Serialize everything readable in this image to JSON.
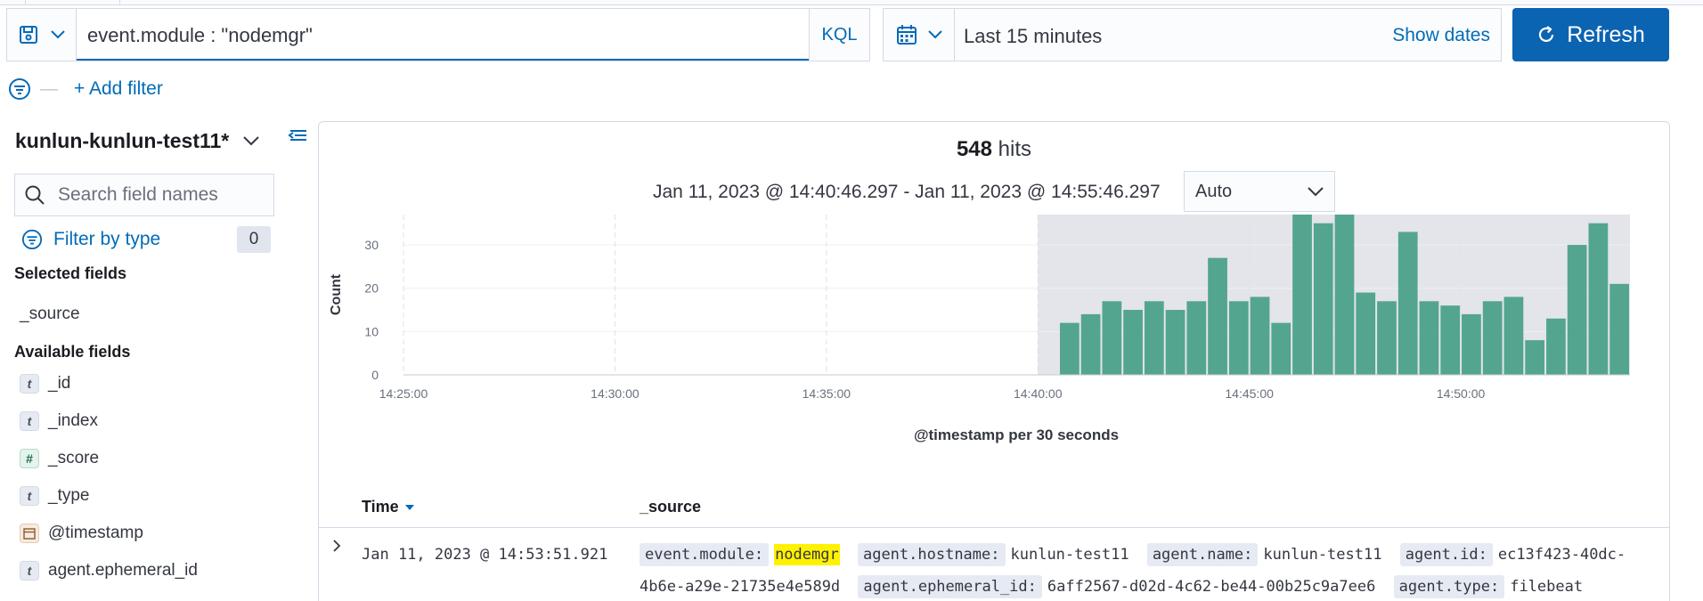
{
  "query": {
    "value": "event.module : \"nodemgr\"",
    "language": "KQL"
  },
  "date": {
    "range": "Last 15 minutes",
    "show_dates": "Show dates"
  },
  "refresh": {
    "label": "Refresh"
  },
  "filters": {
    "add_label": "+ Add filter"
  },
  "sidebar": {
    "index_pattern": "kunlun-kunlun-test11*",
    "search_placeholder": "Search field names",
    "filter_by_type": "Filter by type",
    "filter_count": "0",
    "selected_heading": "Selected fields",
    "selected_fields": [
      {
        "name": "_source",
        "type": "source"
      }
    ],
    "available_heading": "Available fields",
    "available_fields": [
      {
        "name": "_id",
        "type": "t"
      },
      {
        "name": "_index",
        "type": "t"
      },
      {
        "name": "_score",
        "type": "#"
      },
      {
        "name": "_type",
        "type": "t"
      },
      {
        "name": "@timestamp",
        "type": "date"
      },
      {
        "name": "agent.ephemeral_id",
        "type": "t"
      }
    ]
  },
  "main": {
    "hits_count": "548",
    "hits_label": "hits",
    "time_range": "Jan 11, 2023 @ 14:40:46.297 - Jan 11, 2023 @ 14:55:46.297",
    "interval": "Auto"
  },
  "chart_data": {
    "type": "bar",
    "ylabel": "Count",
    "xlabel": "@timestamp per 30 seconds",
    "ylim": [
      0,
      37
    ],
    "yticks": [
      0,
      10,
      20,
      30
    ],
    "xticks": [
      "14:25:00",
      "14:30:00",
      "14:35:00",
      "14:40:00",
      "14:45:00",
      "14:50:00"
    ],
    "x_start": "14:25:00",
    "x_end": "14:54:00",
    "selected_range": [
      "14:40:00",
      "14:54:00"
    ],
    "bar_color": "#54a58f",
    "bars": [
      {
        "x": "14:40:30",
        "value": 12
      },
      {
        "x": "14:41:00",
        "value": 14
      },
      {
        "x": "14:41:30",
        "value": 17
      },
      {
        "x": "14:42:00",
        "value": 15
      },
      {
        "x": "14:42:30",
        "value": 17
      },
      {
        "x": "14:43:00",
        "value": 15
      },
      {
        "x": "14:43:30",
        "value": 17
      },
      {
        "x": "14:44:00",
        "value": 27
      },
      {
        "x": "14:44:30",
        "value": 17
      },
      {
        "x": "14:45:00",
        "value": 18
      },
      {
        "x": "14:45:30",
        "value": 12
      },
      {
        "x": "14:46:00",
        "value": 37
      },
      {
        "x": "14:46:30",
        "value": 35
      },
      {
        "x": "14:47:00",
        "value": 37
      },
      {
        "x": "14:47:30",
        "value": 19
      },
      {
        "x": "14:48:00",
        "value": 17
      },
      {
        "x": "14:48:30",
        "value": 33
      },
      {
        "x": "14:49:00",
        "value": 17
      },
      {
        "x": "14:49:30",
        "value": 16
      },
      {
        "x": "14:50:00",
        "value": 14
      },
      {
        "x": "14:50:30",
        "value": 17
      },
      {
        "x": "14:51:00",
        "value": 18
      },
      {
        "x": "14:51:30",
        "value": 8
      },
      {
        "x": "14:52:00",
        "value": 13
      },
      {
        "x": "14:52:30",
        "value": 30
      },
      {
        "x": "14:53:00",
        "value": 35
      },
      {
        "x": "14:53:30",
        "value": 21
      }
    ]
  },
  "table": {
    "columns": [
      "Time",
      "_source"
    ],
    "rows": [
      {
        "time": "Jan 11, 2023 @ 14:53:51.921",
        "source": [
          {
            "key": "event.module:",
            "value": "nodemgr",
            "highlight": true
          },
          {
            "key": "agent.hostname:",
            "value": "kunlun-test11"
          },
          {
            "key": "agent.name:",
            "value": "kunlun-test11"
          },
          {
            "key": "agent.id:",
            "value": "ec13f423-40dc-4b6e-a29e-21735e4e589d"
          },
          {
            "key": "agent.ephemeral_id:",
            "value": "6aff2567-d02d-4c62-be44-00b25c9a7ee6"
          },
          {
            "key": "agent.type:",
            "value": "filebeat"
          }
        ]
      }
    ]
  }
}
